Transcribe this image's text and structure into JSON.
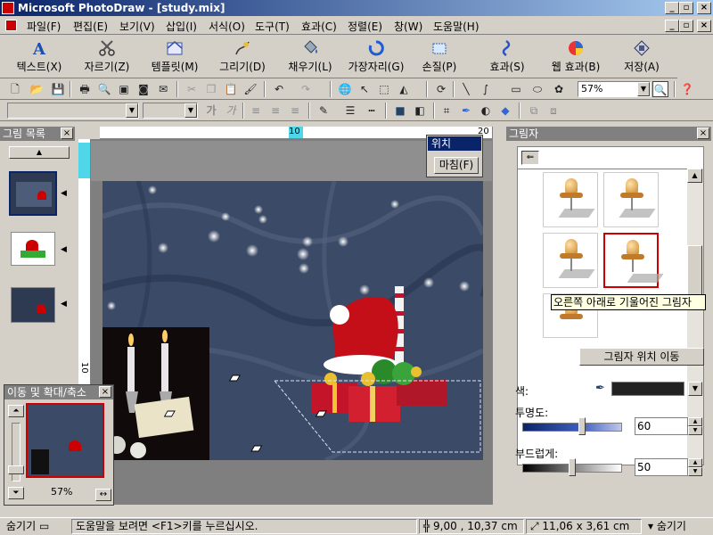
{
  "window": {
    "title": "Microsoft PhotoDraw - [study.mix]"
  },
  "menu": [
    "파일(F)",
    "편집(E)",
    "보기(V)",
    "삽입(I)",
    "서식(O)",
    "도구(T)",
    "효과(C)",
    "정렬(E)",
    "창(W)",
    "도움말(H)"
  ],
  "big_toolbar": [
    {
      "label": "텍스트(X)",
      "icon": "text-a-icon"
    },
    {
      "label": "자르기(Z)",
      "icon": "scissors-icon"
    },
    {
      "label": "템플릿(M)",
      "icon": "template-icon"
    },
    {
      "label": "그리기(D)",
      "icon": "draw-icon"
    },
    {
      "label": "채우기(L)",
      "icon": "fill-bucket-icon"
    },
    {
      "label": "가장자리(G)",
      "icon": "edge-icon"
    },
    {
      "label": "손질(P)",
      "icon": "touchup-icon"
    },
    {
      "label": "효과(S)",
      "icon": "effects-icon"
    },
    {
      "label": "웹 효과(B)",
      "icon": "web-effects-icon"
    },
    {
      "label": "저장(A)",
      "icon": "save-diamond-icon"
    }
  ],
  "std_toolbar": {
    "zoom_value": "57%"
  },
  "format_toolbar": {
    "bold": "가",
    "italic": "가"
  },
  "ruler": {
    "h_label_10": "10",
    "h_label_20": "20",
    "v_label_10": "10"
  },
  "position_popup": {
    "title": "위치",
    "button": "마침(F)"
  },
  "left_panel": {
    "title": "그림 목록"
  },
  "pan_zoom": {
    "title": "이동 및 확대/축소",
    "zoom": "57%"
  },
  "right_panel": {
    "title": "그림자",
    "tooltip": "오른쪽 아래로 기울어진 그림자",
    "move_button": "그림자 위치 이동",
    "color_label": "색:",
    "transparency_label": "투명도:",
    "transparency_value": "60",
    "softness_label": "부드럽게:",
    "softness_value": "50",
    "transparency_level_percent": 60,
    "softness_level_percent": 50
  },
  "statusbar": {
    "hide_left": "숨기기",
    "help": "도움말을 보려면 <F1>키를 누르십시오.",
    "position": "9,00 , 10,37  cm",
    "size": "11,06 x 3,61  cm",
    "hide_right": "숨기기"
  },
  "colors": {
    "title_start": "#0a246a",
    "title_end": "#a6caf0",
    "selection": "#c00000",
    "photo_bg": "#34435e"
  }
}
